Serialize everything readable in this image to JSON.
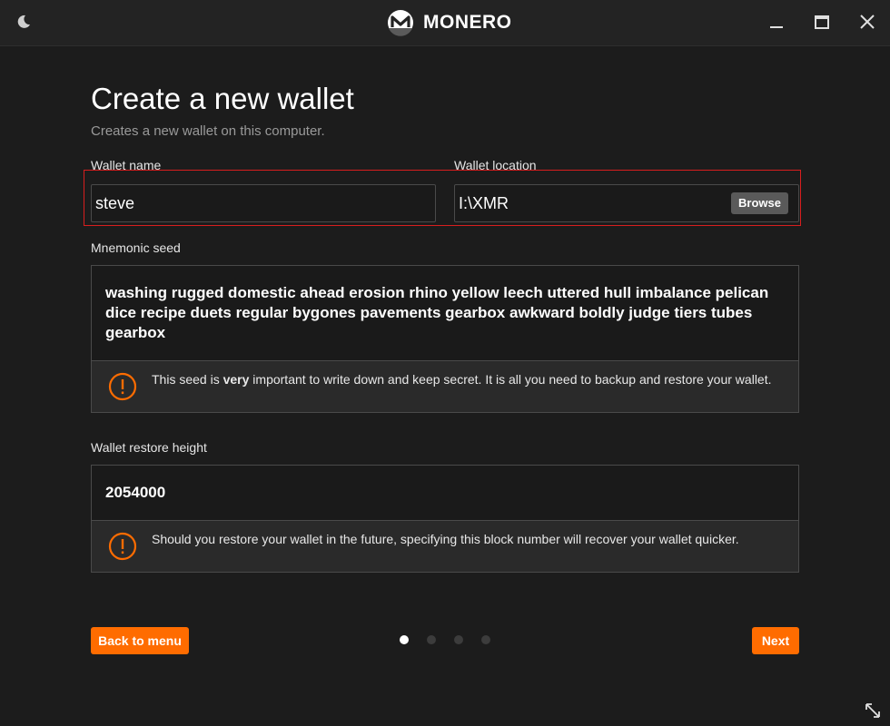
{
  "titlebar": {
    "app_name": "MONERO",
    "icons": {
      "theme_toggle": "moon-icon",
      "logo": "monero-logo-icon",
      "minimize": "minimize-icon",
      "maximize": "maximize-icon",
      "close": "close-icon"
    }
  },
  "page": {
    "title": "Create a new wallet",
    "subtitle": "Creates a new wallet on this computer."
  },
  "wallet_name": {
    "label": "Wallet name",
    "value": "steve"
  },
  "wallet_location": {
    "label": "Wallet location",
    "value": "I:\\XMR",
    "browse_label": "Browse"
  },
  "mnemonic": {
    "label": "Mnemonic seed",
    "seed": "washing rugged domestic ahead erosion rhino yellow leech uttered hull imbalance pelican dice recipe duets regular bygones pavements gearbox awkward boldly judge tiers tubes gearbox",
    "warning_before": "This seed is ",
    "warning_emphasis": "very",
    "warning_after": " important to write down and keep secret. It is all you need to backup and restore your wallet.",
    "warning_icon": "warning-icon"
  },
  "restore_height": {
    "label": "Wallet restore height",
    "value": "2054000",
    "warning": "Should you restore your wallet in the future, specifying this block number will recover your wallet quicker.",
    "warning_icon": "warning-icon"
  },
  "nav": {
    "back_label": "Back to menu",
    "next_label": "Next",
    "page_count": 4,
    "current_page": 1
  },
  "colors": {
    "accent": "#ff6c00",
    "background": "#1c1c1c",
    "highlight": "#d81e1e"
  }
}
